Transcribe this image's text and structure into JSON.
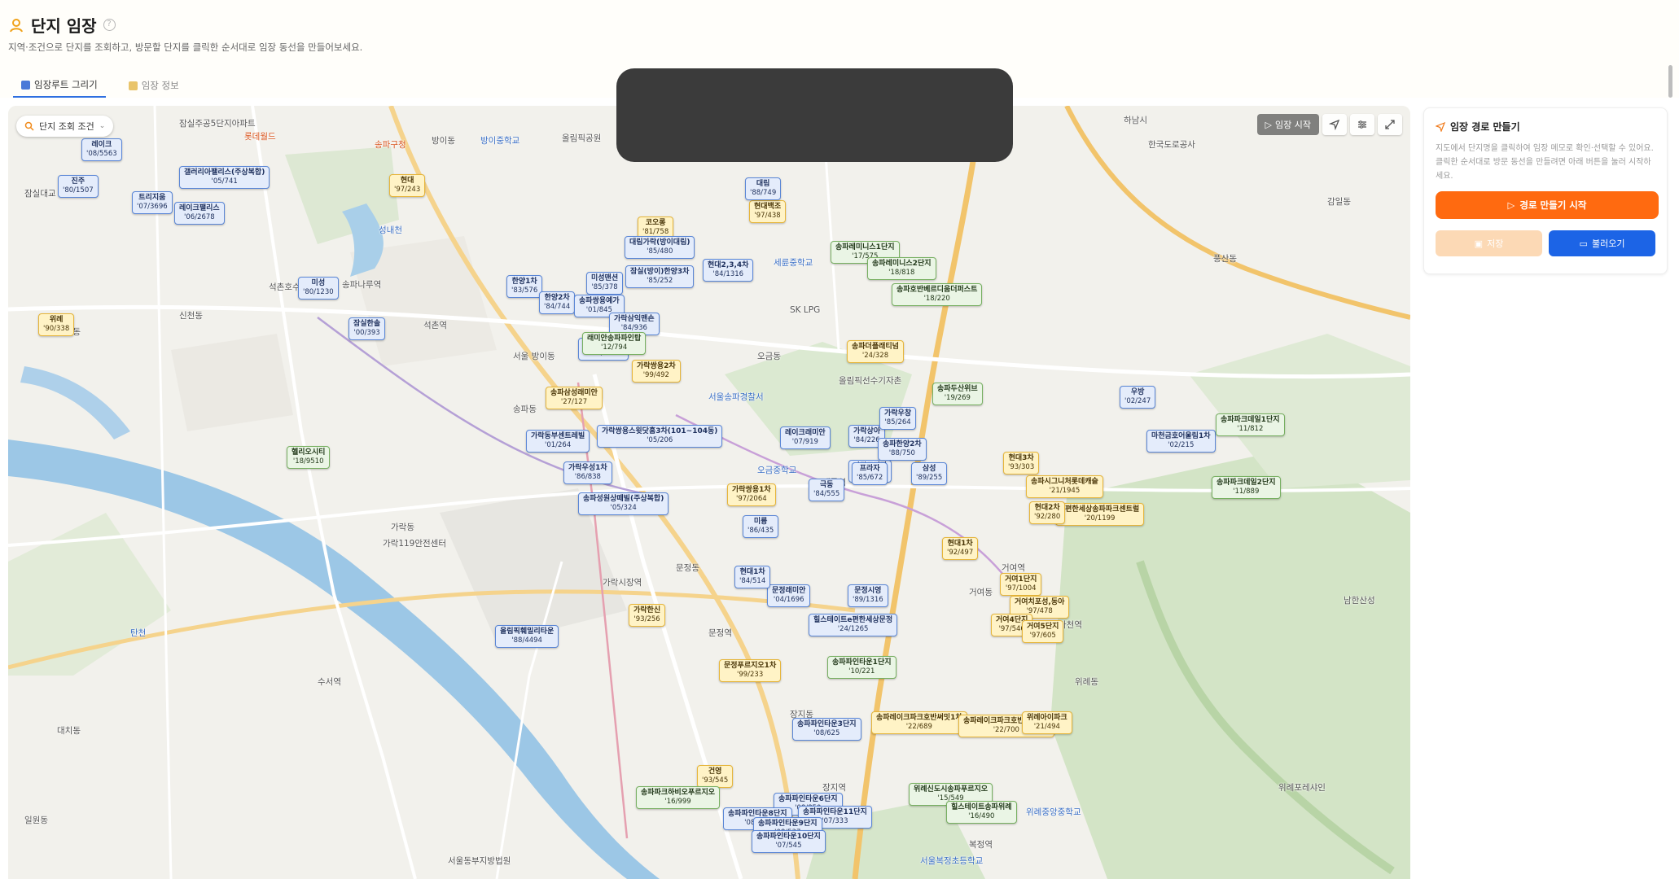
{
  "header": {
    "title": "단지 임장",
    "subtitle": "지역·조건으로 단지를 조회하고, 방문할 단지를 클릭한 순서대로 임장 동선을 만들어보세요."
  },
  "tabs": [
    {
      "label": "임장루트 그리기",
      "active": true
    },
    {
      "label": "임장 정보",
      "active": false
    }
  ],
  "map": {
    "search_chip_label": "단지 조회 조건",
    "start_label": "임장 시작",
    "places": [
      "잠실주공5단지아파트",
      "송파구청",
      "롯데월드",
      "잠실대교",
      "방이동",
      "방이중학교",
      "올림픽공원",
      "석촌호수",
      "신천동",
      "잠실동",
      "송파나루역",
      "석촌역",
      "가락시장역",
      "가락동",
      "송파동",
      "문정동",
      "장지동",
      "위례동",
      "거여동",
      "마천동",
      "오금동",
      "개롱역",
      "거여역",
      "마천역",
      "올림픽선수기자촌",
      "SK LPG",
      "세륜중학교",
      "오금중학교",
      "문정역",
      "복정역",
      "장지역",
      "수서역",
      "일원동",
      "대치동",
      "탄천",
      "성내천",
      "위례포레샤인",
      "감일동",
      "하남시",
      "풍산동",
      "서울 방이동",
      "서울동부지방법원",
      "서울송파경찰서",
      "가락119안전센터",
      "위례중앙중학교",
      "남한산성",
      "서울복정초등학교",
      "한국도로공사"
    ],
    "markers": [
      {
        "name": "현대",
        "sub": "'97/243",
        "color": "yellow"
      },
      {
        "name": "코오롱",
        "sub": "'81/758",
        "color": "yellow"
      },
      {
        "name": "대림가락(방이대림)",
        "sub": "'85/480",
        "color": "blue"
      },
      {
        "name": "현대백조",
        "sub": "'97/438",
        "color": "yellow"
      },
      {
        "name": "대림",
        "sub": "'88/749",
        "color": "blue"
      },
      {
        "name": "현대2,3,4차",
        "sub": "'84/1316",
        "color": "blue"
      },
      {
        "name": "송파레미니스1단지",
        "sub": "'17/575",
        "color": "green"
      },
      {
        "name": "송파레미니스2단지",
        "sub": "'18/818",
        "color": "green"
      },
      {
        "name": "송파호반베르디움더퍼스트",
        "sub": "'18/220",
        "color": "green"
      },
      {
        "name": "잠실(방이)한양3차",
        "sub": "'85/252",
        "color": "blue"
      },
      {
        "name": "미성맨션",
        "sub": "'85/378",
        "color": "blue"
      },
      {
        "name": "한양1차",
        "sub": "'83/576",
        "color": "blue"
      },
      {
        "name": "한양2차",
        "sub": "'84/744",
        "color": "blue"
      },
      {
        "name": "송파쌍용예가",
        "sub": "'01/845",
        "color": "blue"
      },
      {
        "name": "가락쌍용1차",
        "sub": "'97/2064",
        "color": "yellow"
      },
      {
        "name": "레이크팰리스",
        "sub": "'06/2678",
        "color": "blue"
      },
      {
        "name": "트리지움",
        "sub": "'07/3696",
        "color": "blue"
      },
      {
        "name": "갤러리아팰리스(주상복합)",
        "sub": "'05/741",
        "color": "blue"
      },
      {
        "name": "진주",
        "sub": "'80/1507",
        "color": "blue"
      },
      {
        "name": "미성",
        "sub": "'80/1230",
        "color": "blue"
      },
      {
        "name": "잠실한솔",
        "sub": "'00/393",
        "color": "blue"
      },
      {
        "name": "레이크",
        "sub": "'08/5563",
        "color": "blue"
      },
      {
        "name": "위례",
        "sub": "'90/338",
        "color": "yellow"
      },
      {
        "name": "송파파인타운",
        "sub": "'12/794",
        "color": "blue"
      },
      {
        "name": "가락쌍용2차",
        "sub": "'99/492",
        "color": "yellow"
      },
      {
        "name": "가락삼익맨숀",
        "sub": "'84/936",
        "color": "blue"
      },
      {
        "name": "래미안송파파인탑",
        "sub": "'12/794",
        "color": "green"
      },
      {
        "name": "송파더플래티넘",
        "sub": "'24/328",
        "color": "yellow"
      },
      {
        "name": "송파두산위브",
        "sub": "'19/269",
        "color": "green"
      },
      {
        "name": "가락프라자",
        "sub": "'85/672",
        "color": "blue"
      },
      {
        "name": "레이크래미안",
        "sub": "'07/919",
        "color": "blue"
      },
      {
        "name": "가락상아",
        "sub": "'84/226",
        "color": "blue"
      },
      {
        "name": "가락우창",
        "sub": "'85/264",
        "color": "blue"
      },
      {
        "name": "송파한양2차",
        "sub": "'88/750",
        "color": "blue"
      },
      {
        "name": "가락동부센트레빌",
        "sub": "'01/264",
        "color": "blue"
      },
      {
        "name": "가락쌍용스윗닷홈3차(101~104동)",
        "sub": "'05/206",
        "color": "blue"
      },
      {
        "name": "송파성원상떼빌(주상복합)",
        "sub": "'05/324",
        "color": "blue"
      },
      {
        "name": "송파삼성래미안",
        "sub": "'27/127",
        "color": "yellow"
      },
      {
        "name": "가락우성1차",
        "sub": "'86/838",
        "color": "blue"
      },
      {
        "name": "헬리오시티",
        "sub": "'18/9510",
        "color": "green"
      },
      {
        "name": "극동",
        "sub": "'84/555",
        "color": "blue"
      },
      {
        "name": "프라자",
        "sub": "'85/672",
        "color": "blue"
      },
      {
        "name": "삼성",
        "sub": "'89/255",
        "color": "blue"
      },
      {
        "name": "현대3차",
        "sub": "'93/303",
        "color": "yellow"
      },
      {
        "name": "올림픽훼밀리타운",
        "sub": "'88/4494",
        "color": "blue"
      },
      {
        "name": "문정래미안",
        "sub": "'04/1696",
        "color": "blue"
      },
      {
        "name": "문정시영",
        "sub": "'89/1316",
        "color": "blue"
      },
      {
        "name": "현대1차",
        "sub": "'84/514",
        "color": "blue"
      },
      {
        "name": "가락한신",
        "sub": "'93/256",
        "color": "yellow"
      },
      {
        "name": "미륭",
        "sub": "'86/435",
        "color": "blue"
      },
      {
        "name": "힐스테이트e편한세상문정",
        "sub": "'24/1265",
        "color": "blue"
      },
      {
        "name": "문정푸르지오1차",
        "sub": "'99/233",
        "color": "yellow"
      },
      {
        "name": "송파파인타운1단지",
        "sub": "'10/221",
        "color": "green"
      },
      {
        "name": "우방",
        "sub": "'02/247",
        "color": "blue"
      },
      {
        "name": "마천금호어울림1차",
        "sub": "'02/215",
        "color": "blue"
      },
      {
        "name": "송파파크데일1단지",
        "sub": "'11/812",
        "color": "green"
      },
      {
        "name": "송파파크데일2단지",
        "sub": "'11/889",
        "color": "green"
      },
      {
        "name": "송파시그니처롯데캐슬",
        "sub": "'21/1945",
        "color": "yellow"
      },
      {
        "name": "e편한세상송파파크센트럴",
        "sub": "'20/1199",
        "color": "yellow"
      },
      {
        "name": "현대2차",
        "sub": "'92/280",
        "color": "yellow"
      },
      {
        "name": "현대1차",
        "sub": "'92/497",
        "color": "yellow"
      },
      {
        "name": "거여1단지",
        "sub": "'97/1004",
        "color": "yellow"
      },
      {
        "name": "거여치포성,동아",
        "sub": "'97/478",
        "color": "yellow"
      },
      {
        "name": "거여4단지",
        "sub": "'97/546",
        "color": "yellow"
      },
      {
        "name": "거여5단지",
        "sub": "'97/605",
        "color": "yellow"
      },
      {
        "name": "송파파인타운3단지",
        "sub": "'08/625",
        "color": "blue"
      },
      {
        "name": "송파레이크파크호반써밋1차",
        "sub": "'22/689",
        "color": "yellow"
      },
      {
        "name": "송파레이크파크호반써밋2차",
        "sub": "'22/700",
        "color": "yellow"
      },
      {
        "name": "위례아이파크",
        "sub": "'21/494",
        "color": "yellow"
      },
      {
        "name": "건영",
        "sub": "'93/545",
        "color": "yellow"
      },
      {
        "name": "송파파크하비오푸르지오",
        "sub": "'16/999",
        "color": "green"
      },
      {
        "name": "송파파인타운6단지",
        "sub": "'08/850",
        "color": "blue"
      },
      {
        "name": "송파파인타운8단지",
        "sub": "'08/700",
        "color": "blue"
      },
      {
        "name": "송파파인타운11단지",
        "sub": "'07/333",
        "color": "blue"
      },
      {
        "name": "송파파인타운9단지",
        "sub": "'08/537",
        "color": "blue"
      },
      {
        "name": "송파파인타운10단지",
        "sub": "'07/545",
        "color": "blue"
      },
      {
        "name": "위례신도시송파푸르지오",
        "sub": "'15/549",
        "color": "green"
      },
      {
        "name": "힐스테이트송파위례",
        "sub": "'16/490",
        "color": "green"
      }
    ]
  },
  "side_panel": {
    "title": "임장 경로 만들기",
    "description": "지도에서 단지명을 클릭하여 임장 메모로 확인·선택할 수 있어요. 클릭한 순서대로 방문 동선을 만들려면 아래 버튼을 눌러 시작하세요.",
    "start_button": "경로 만들기 시작",
    "save_button": "저장",
    "load_button": "불러오기"
  },
  "colors": {
    "accent_orange": "#ff6a10",
    "accent_blue": "#1c64e6",
    "save_disabled": "#fcd9b5"
  }
}
